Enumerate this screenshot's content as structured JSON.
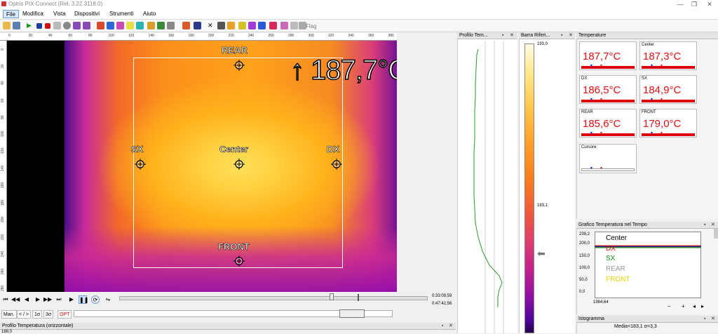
{
  "window": {
    "title": "Optris PIX Connect (Rel. 3.22.3118.0)"
  },
  "menu": [
    "File",
    "Modifica",
    "Vista",
    "Dispositivi",
    "Strumenti",
    "Aiuto"
  ],
  "toolbar": {
    "flag_label": "Flag"
  },
  "ruler": {
    "x_ticks": [
      "0",
      "20",
      "40",
      "60",
      "80",
      "100",
      "120",
      "140",
      "160",
      "180",
      "200",
      "220",
      "240",
      "260",
      "280",
      "300",
      "320",
      "340",
      "360",
      "380"
    ],
    "y_ticks": [
      "0",
      "20",
      "40",
      "60",
      "80",
      "100",
      "120",
      "140",
      "160",
      "180",
      "200",
      "220",
      "240",
      "260",
      "280"
    ]
  },
  "thermal": {
    "max_temp": "↑ 187,7°C",
    "markers": {
      "rear": "REAR",
      "center": "Center",
      "sx": "SX",
      "dx": "DX",
      "front": "FRONT"
    }
  },
  "playback": {
    "time_current": "0:33:09,59",
    "time_total": "0:47:42,56",
    "controls": [
      "⏮",
      "◀◀",
      "◀",
      "▶",
      "▶▶",
      "⏭",
      "▶",
      "❚❚"
    ]
  },
  "modes": [
    "Man.",
    "< / >",
    "1σ",
    "3σ",
    "OPT"
  ],
  "panels": {
    "profile_h": "Profilo Temperatura (orizzontale)",
    "profile_h_value": "188,0",
    "profile_v": "Profilo Tem...",
    "scale": "Barra Riferi...",
    "temperature": "Temperature",
    "graph": "Grafico Temperatura nel Tempo",
    "histogram": "Istogramma"
  },
  "scale_bar": {
    "max": "193,0",
    "mid": "183,1"
  },
  "temperatures": [
    {
      "name": "",
      "value": "187,7°C"
    },
    {
      "name": "Center",
      "value": "187,3°C"
    },
    {
      "name": "DX",
      "value": "186,5°C"
    },
    {
      "name": "SX",
      "value": "184,9°C"
    },
    {
      "name": "REAR",
      "value": "185,6°C"
    },
    {
      "name": "FRONT",
      "value": "179,0°C"
    }
  ],
  "cursor": {
    "name": "Cursore:"
  },
  "graph": {
    "y_ticks": [
      "239,2",
      "200,0",
      "150,0",
      "100,0",
      "50,0",
      "0,0"
    ],
    "x_label": "1984,64",
    "legend": [
      {
        "name": "Center",
        "color": "#000000"
      },
      {
        "name": "DX",
        "color": "#e01010"
      },
      {
        "name": "SX",
        "color": "#109010"
      },
      {
        "name": "REAR",
        "color": "#999999"
      },
      {
        "name": "FRONT",
        "color": "#e6d200"
      }
    ]
  },
  "histogram": {
    "stats": "Media=183,1 σ=3,3"
  }
}
